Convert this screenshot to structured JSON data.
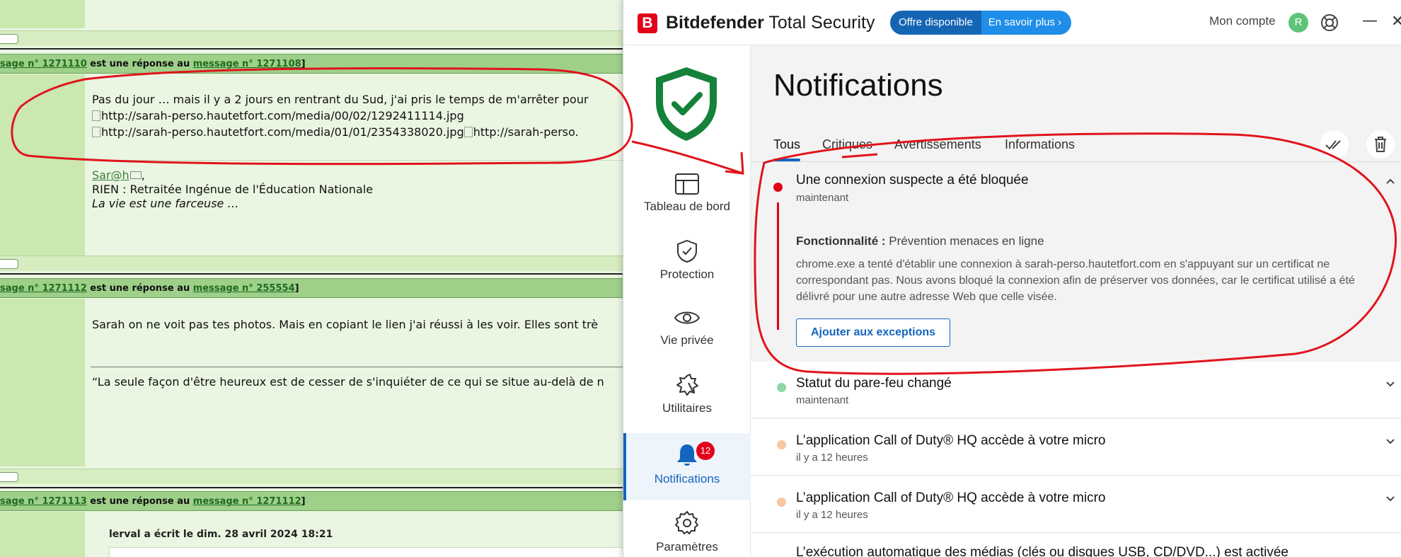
{
  "forum": {
    "post1": {
      "header_a": "sage n° 1271110",
      "header_mid": " est une réponse au ",
      "header_b": "message n° 1271108",
      "header_end": "]",
      "line1": "Pas du jour … mais il y a 2 jours en rentrant du Sud, j'ai pris le temps de m'arrêter pour",
      "line2": "http://sarah-perso.hautetfort.com/media/00/02/1292411114.jpg",
      "line3": "http://sarah-perso.hautetfort.com/media/01/01/2354338020.jpg",
      "line3b": "http://sarah-perso.",
      "sig_name": "Sar@h",
      "sig_comma": ",",
      "sig_line2": "RIEN : Retraitée Ingénue de l'Éducation Nationale",
      "sig_line3": "La vie est une farceuse …"
    },
    "post2": {
      "header_a": "sage n° 1271112",
      "header_mid": " est une réponse au ",
      "header_b": "message n° 255554",
      "header_end": "]",
      "line1": "Sarah on ne voit pas tes photos. Mais en copiant le lien j'ai réussi à les voir. Elles sont trè",
      "quote": "“La seule façon d'être heureux est de cesser de s'inquiéter de ce qui se situe au-delà de n"
    },
    "post3": {
      "header_a": "sage n° 1271113",
      "header_mid": " est une réponse au ",
      "header_b": "message n° 1271112",
      "header_end": "]",
      "quote_intro": "lerval a écrit le dim. 28 avril 2024 18:21"
    }
  },
  "bitdefender": {
    "logo_letter": "B",
    "brand_bold": "Bitdefender",
    "brand_rest": " Total Security",
    "offer_label": "Offre disponible",
    "offer_link": "En savoir plus ›",
    "account_label": "Mon compte",
    "avatar_letter": "R",
    "minimize": "—",
    "close": "✕",
    "sidebar": [
      {
        "label": "Tableau de bord",
        "icon": "dashboard-icon"
      },
      {
        "label": "Protection",
        "icon": "shield-check-icon"
      },
      {
        "label": "Vie privée",
        "icon": "eye-icon"
      },
      {
        "label": "Utilitaires",
        "icon": "tools-icon"
      },
      {
        "label": "Notifications",
        "icon": "bell-icon",
        "badge": "12"
      },
      {
        "label": "Paramètres",
        "icon": "gear-icon"
      }
    ],
    "page_title": "Notifications",
    "tabs": [
      "Tous",
      "Critiques",
      "Avertissements",
      "Informations"
    ],
    "notifications": [
      {
        "title": "Une connexion suspecte a été bloquée",
        "time": "maintenant",
        "feature_label": "Fonctionnalité :",
        "feature_value": "Prévention menaces en ligne",
        "description": "chrome.exe a tenté d'établir une connexion à sarah-perso.hautetfort.com en s'appuyant sur un certificat ne correspondant pas. Nous avons bloqué la connexion afin de préserver vos données, car le certificat utilisé a été délivré pour une autre adresse Web que celle visée.",
        "action": "Ajouter aux exceptions"
      },
      {
        "title": "Statut du pare-feu changé",
        "time": "maintenant"
      },
      {
        "title": "L’application Call of Duty® HQ accède à votre micro",
        "time": "il y a 12 heures"
      },
      {
        "title": "L’application Call of Duty® HQ accède à votre micro",
        "time": "il y a 12 heures"
      },
      {
        "title": "L’exécution automatique des médias (clés ou disques USB, CD/DVD...) est activée",
        "time": ""
      }
    ],
    "colors": {
      "brand_red": "#e2001a",
      "accent_blue": "#1565c0",
      "status_green": "#8fd6a4",
      "status_orange": "#f7c6a3",
      "annotation_red": "#e0141c"
    }
  }
}
